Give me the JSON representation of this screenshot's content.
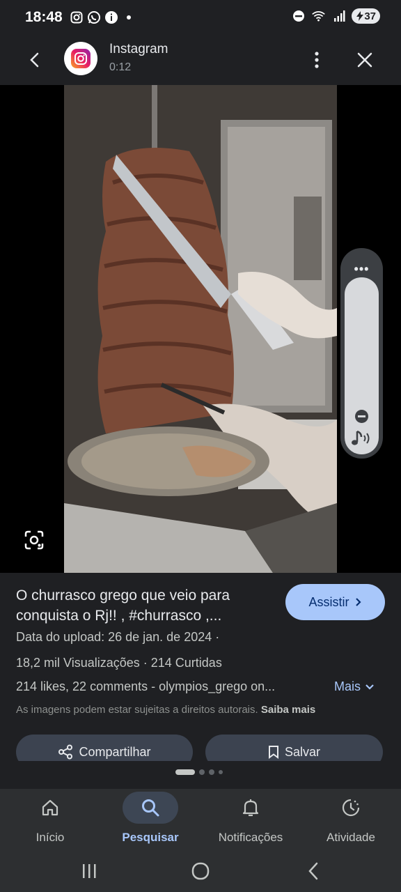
{
  "status_bar": {
    "time": "18:48",
    "battery": "37",
    "left_icons": [
      "instagram-icon",
      "whatsapp-icon",
      "info-icon",
      "dot-icon"
    ],
    "right_icons": [
      "dnd-icon",
      "wifi-icon",
      "signal-icon",
      "battery-icon"
    ]
  },
  "header": {
    "title": "Instagram",
    "subtitle": "0:12"
  },
  "volume": {
    "dots": "•••",
    "level": 0.95
  },
  "info": {
    "title": "O churrasco grego que veio para conquista o Rj!! , #churrasco ,...",
    "watch_label": "Assistir",
    "upload": "Data do upload: 26 de jan. de 2024  ·",
    "stats": "18,2 mil Visualizações  ·  214 Curtidas",
    "description": "214 likes, 22 comments - olympios_grego on...",
    "more_label": "Mais",
    "rights_text": "As imagens podem estar sujeitas a direitos autorais.",
    "rights_link": "Saiba mais",
    "share_label": "Compartilhar",
    "save_label": "Salvar"
  },
  "pager": {
    "count": 4,
    "active": 0
  },
  "bottom_nav": {
    "items": [
      {
        "label": "Início",
        "icon": "home-icon"
      },
      {
        "label": "Pesquisar",
        "icon": "search-icon",
        "active": true
      },
      {
        "label": "Notificações",
        "icon": "bell-icon"
      },
      {
        "label": "Atividade",
        "icon": "activity-icon"
      }
    ]
  },
  "colors": {
    "background": "#1f2023",
    "accent": "#a8c7fa",
    "button_bg": "#3c4350"
  }
}
